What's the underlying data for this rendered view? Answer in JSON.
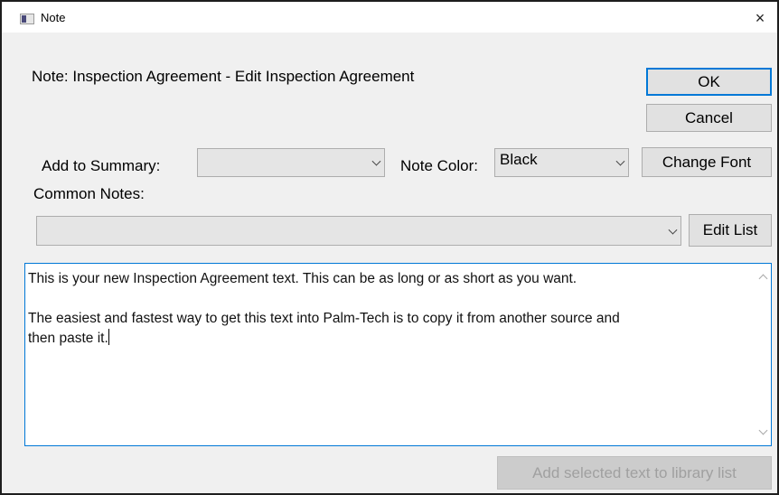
{
  "window": {
    "title": "Note",
    "close_label": "×"
  },
  "header": {
    "note_label": "Note: Inspection Agreement  - Edit Inspection Agreement"
  },
  "buttons": {
    "ok": "OK",
    "cancel": "Cancel",
    "change_font": "Change Font",
    "edit_list": "Edit List",
    "add_selected": "Add selected text to library list"
  },
  "summary": {
    "label": "Add to Summary:",
    "selected": ""
  },
  "note_color": {
    "label": "Note Color:",
    "selected": "Black"
  },
  "common_notes": {
    "label": "Common Notes:",
    "selected": ""
  },
  "note_text": {
    "line1": "This is your new Inspection Agreement text. This can be as long or as short as you want.",
    "line2": "The easiest and fastest way to get this text into Palm-Tech is to copy it from another source and",
    "line3": "then paste it."
  }
}
